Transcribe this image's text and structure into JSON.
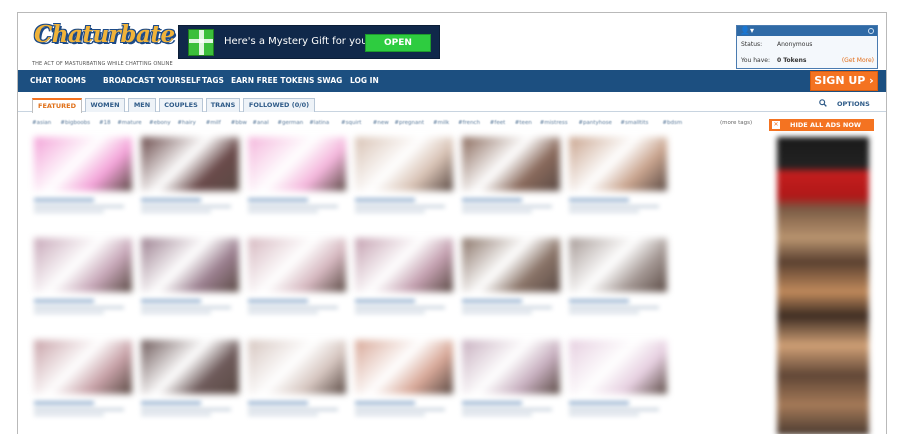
{
  "logo": {
    "text": "Chaturbate",
    "tagline": "THE ACT OF MASTURBATING WHILE CHATTING ONLINE"
  },
  "gift_banner": {
    "text": "Here's a Mystery Gift for you",
    "button_label": "OPEN"
  },
  "user_box": {
    "status_label": "Status:",
    "status_value": "Anonymous",
    "tokens_label": "You have:",
    "tokens_value": "0 Tokens",
    "get_more": "(Get More)"
  },
  "nav": {
    "items": [
      "CHAT ROOMS",
      "BROADCAST YOURSELF",
      "TAGS",
      "EARN FREE TOKENS",
      "SWAG",
      "LOG IN"
    ],
    "signup_label": "SIGN UP ›"
  },
  "tabs": {
    "items": [
      "FEATURED",
      "WOMEN",
      "MEN",
      "COUPLES",
      "TRANS",
      "FOLLOWED (0/0)"
    ],
    "active": "FEATURED",
    "options_label": "OPTIONS"
  },
  "tags": {
    "items": [
      "#asian",
      "#bigboobs",
      "#18",
      "#mature",
      "#ebony",
      "#hairy",
      "#milf",
      "#bbw",
      "#anal",
      "#german",
      "#latina",
      "#squirt",
      "#new",
      "#pregnant",
      "#milk",
      "#french",
      "#feet",
      "#teen",
      "#mistress",
      "#pantyhose",
      "#smalltits",
      "#bdsm"
    ],
    "more_label": "(more tags)",
    "hide_ads_label": "HIDE ALL ADS NOW"
  },
  "colors": {
    "nav_bg": "#1c4f80",
    "accent_orange": "#f47321",
    "gift_banner_bg": "#10284a",
    "open_green": "#2ecc40"
  },
  "thumbnails": [
    [
      "#f3a3d8",
      "#6a4a4a",
      "#f4b6dc",
      "#d8c2b4",
      "#8a6a5c",
      "#c9a48e"
    ],
    [
      "#c7a7b8",
      "#9c8090",
      "#d6b8c0",
      "#c4a0b0",
      "#8a7468",
      "#a69a96"
    ],
    [
      "#c8a2a8",
      "#6e5a5a",
      "#d6c6c0",
      "#d8a898",
      "#c8b0c0",
      "#e6cfe0"
    ]
  ]
}
